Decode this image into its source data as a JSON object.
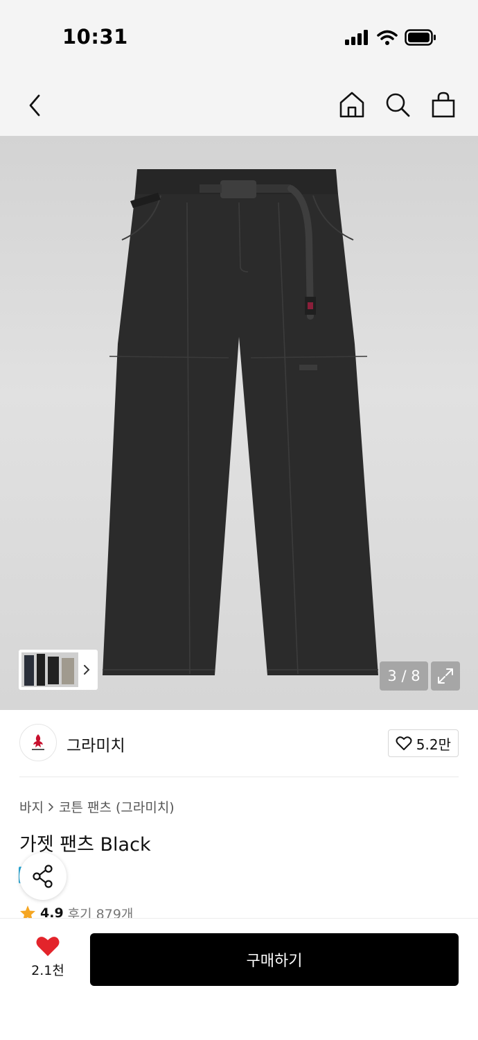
{
  "status_bar": {
    "time": "10:31"
  },
  "hero": {
    "page_counter": "3 / 8"
  },
  "brand": {
    "name": "그라미치",
    "like_count": "5.2만"
  },
  "breadcrumb": {
    "category": "바지",
    "subcategory": "코튼 팬츠 (그라미치)"
  },
  "product": {
    "title": "가젯 팬츠 Black",
    "rating": "4.9",
    "review_count": "후기 879개"
  },
  "bottom_bar": {
    "wish_count": "2.1천",
    "buy_label": "구매하기"
  },
  "colors": {
    "heart": "#e3242b",
    "star": "#f5a623",
    "buy_bg": "#000000"
  },
  "icons": [
    "back-chevron-icon",
    "home-icon",
    "search-icon",
    "shopping-bag-icon",
    "expand-icon",
    "heart-outline-icon",
    "share-icon",
    "star-icon",
    "heart-filled-icon"
  ]
}
